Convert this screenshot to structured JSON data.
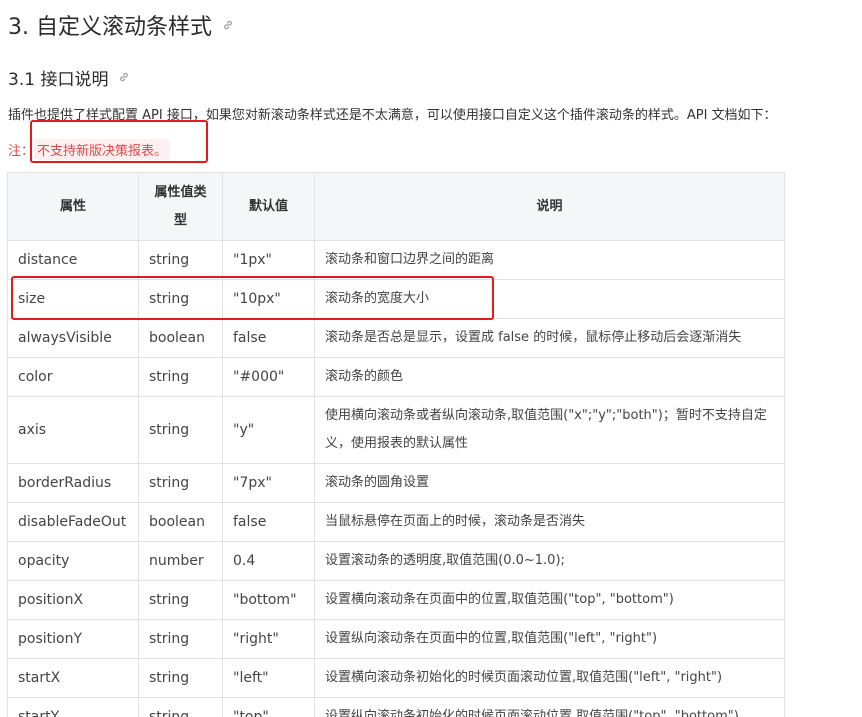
{
  "heading": {
    "title": "3. 自定义滚动条样式",
    "anchor_icon": "link-icon"
  },
  "subheading": {
    "title": "3.1 接口说明",
    "anchor_icon": "link-icon"
  },
  "intro": {
    "part1": "插件也提供了样式配置 ",
    "part2": "API 接口",
    "part3": "，如果您对新滚动条样式还是不太满意，可以使用接口自定义这个插件滚动条的样式。API 文档如下："
  },
  "note": {
    "prefix": "注：",
    "text": "不支持新版决策报表。"
  },
  "table": {
    "headers": [
      "属性",
      "属性值类型",
      "默认值",
      "说明"
    ],
    "rows": [
      [
        "distance",
        "string",
        "\"1px\"",
        "滚动条和窗口边界之间的距离"
      ],
      [
        "size",
        "string",
        "\"10px\"",
        "滚动条的宽度大小"
      ],
      [
        "alwaysVisible",
        "boolean",
        "false",
        "滚动条是否总是显示，设置成 false 的时候，鼠标停止移动后会逐渐消失"
      ],
      [
        "color",
        "string",
        "\"#000\"",
        "滚动条的颜色"
      ],
      [
        "axis",
        "string",
        "\"y\"",
        "使用横向滚动条或者纵向滚动条,取值范围(\"x\";\"y\";\"both\")；暂时不支持自定义，使用报表的默认属性"
      ],
      [
        "borderRadius",
        "string",
        "\"7px\"",
        "滚动条的圆角设置"
      ],
      [
        "disableFadeOut",
        "boolean",
        "false",
        "当鼠标悬停在页面上的时候，滚动条是否消失"
      ],
      [
        "opacity",
        "number",
        "0.4",
        "设置滚动条的透明度,取值范围(0.0~1.0);"
      ],
      [
        "positionX",
        "string",
        "\"bottom\"",
        "设置横向滚动条在页面中的位置,取值范围(\"top\", \"bottom\")"
      ],
      [
        "positionY",
        "string",
        "\"right\"",
        "设置纵向滚动条在页面中的位置,取值范围(\"left\", \"right\")"
      ],
      [
        "startX",
        "string",
        "\"left\"",
        "设置横向滚动条初始化的时候页面滚动位置,取值范围(\"left\", \"right\")"
      ],
      [
        "startY",
        "string",
        "\"top\"",
        "设置纵向滚动条初始化的时候页面滚动位置,取值范围(\"top\", \"bottom\")"
      ]
    ]
  },
  "colors": {
    "highlight_box": "#e31b1b",
    "note_text": "#e0494a",
    "header_bg": "#f5f6f7"
  }
}
